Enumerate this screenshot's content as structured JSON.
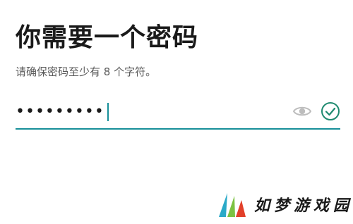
{
  "header": {
    "title": "你需要一个密码",
    "subtitle": "请确保密码至少有 8 个字符。"
  },
  "password_field": {
    "value": "•••••••••",
    "focused": true,
    "valid": true,
    "underline_color": "#178f99",
    "show_password_icon": "eye-icon",
    "validation_icon": "check-circle-icon",
    "validation_color": "#1f8a70"
  },
  "watermark": {
    "text": "如梦游戏园",
    "logo_colors": [
      "#2aa9c8",
      "#7cc242",
      "#e2402a"
    ]
  }
}
